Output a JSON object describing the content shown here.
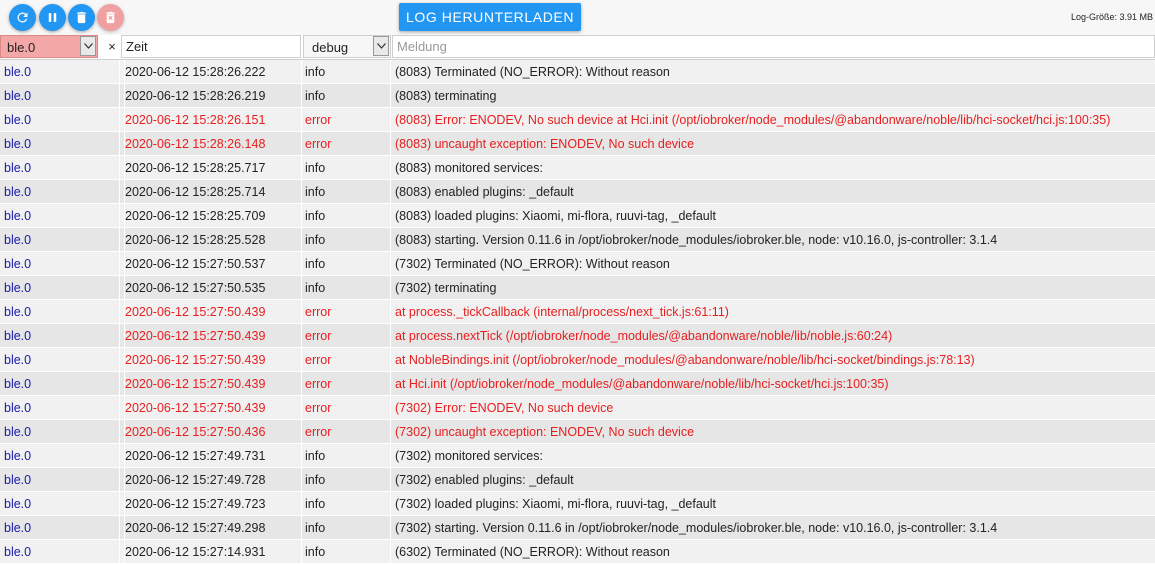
{
  "toolbar": {
    "refresh_icon": "refresh-icon",
    "pause_icon": "pause-icon",
    "clear_icon": "trash-icon",
    "delete_icon": "trash-delete-icon",
    "download_label": "LOG HERUNTERLADEN",
    "log_size": "Log-Größe: 3.91 MB"
  },
  "filters": {
    "source_value": "ble.0",
    "clear_label": "×",
    "time_value": "Zeit",
    "level_value": "debug",
    "message_placeholder": "Meldung"
  },
  "colors": {
    "accent": "#2196f3",
    "error": "#e81e1e",
    "source": "#1a1aa6",
    "filter_active": "#f4a7a7"
  },
  "rows": [
    {
      "source": "ble.0",
      "time": "2020-06-12 15:28:26.222",
      "level": "info",
      "message": "(8083) Terminated (NO_ERROR): Without reason"
    },
    {
      "source": "ble.0",
      "time": "2020-06-12 15:28:26.219",
      "level": "info",
      "message": "(8083) terminating"
    },
    {
      "source": "ble.0",
      "time": "2020-06-12 15:28:26.151",
      "level": "error",
      "message": "(8083) Error: ENODEV, No such device at Hci.init (/opt/iobroker/node_modules/@abandonware/noble/lib/hci-socket/hci.js:100:35)"
    },
    {
      "source": "ble.0",
      "time": "2020-06-12 15:28:26.148",
      "level": "error",
      "message": "(8083) uncaught exception: ENODEV, No such device"
    },
    {
      "source": "ble.0",
      "time": "2020-06-12 15:28:25.717",
      "level": "info",
      "message": "(8083) monitored services:"
    },
    {
      "source": "ble.0",
      "time": "2020-06-12 15:28:25.714",
      "level": "info",
      "message": "(8083) enabled plugins: _default"
    },
    {
      "source": "ble.0",
      "time": "2020-06-12 15:28:25.709",
      "level": "info",
      "message": "(8083) loaded plugins: Xiaomi, mi-flora, ruuvi-tag, _default"
    },
    {
      "source": "ble.0",
      "time": "2020-06-12 15:28:25.528",
      "level": "info",
      "message": "(8083) starting. Version 0.11.6 in /opt/iobroker/node_modules/iobroker.ble, node: v10.16.0, js-controller: 3.1.4"
    },
    {
      "source": "ble.0",
      "time": "2020-06-12 15:27:50.537",
      "level": "info",
      "message": "(7302) Terminated (NO_ERROR): Without reason"
    },
    {
      "source": "ble.0",
      "time": "2020-06-12 15:27:50.535",
      "level": "info",
      "message": "(7302) terminating"
    },
    {
      "source": "ble.0",
      "time": "2020-06-12 15:27:50.439",
      "level": "error",
      "message": "at process._tickCallback (internal/process/next_tick.js:61:11)"
    },
    {
      "source": "ble.0",
      "time": "2020-06-12 15:27:50.439",
      "level": "error",
      "message": "at process.nextTick (/opt/iobroker/node_modules/@abandonware/noble/lib/noble.js:60:24)"
    },
    {
      "source": "ble.0",
      "time": "2020-06-12 15:27:50.439",
      "level": "error",
      "message": "at NobleBindings.init (/opt/iobroker/node_modules/@abandonware/noble/lib/hci-socket/bindings.js:78:13)"
    },
    {
      "source": "ble.0",
      "time": "2020-06-12 15:27:50.439",
      "level": "error",
      "message": "at Hci.init (/opt/iobroker/node_modules/@abandonware/noble/lib/hci-socket/hci.js:100:35)"
    },
    {
      "source": "ble.0",
      "time": "2020-06-12 15:27:50.439",
      "level": "error",
      "message": "(7302) Error: ENODEV, No such device"
    },
    {
      "source": "ble.0",
      "time": "2020-06-12 15:27:50.436",
      "level": "error",
      "message": "(7302) uncaught exception: ENODEV, No such device"
    },
    {
      "source": "ble.0",
      "time": "2020-06-12 15:27:49.731",
      "level": "info",
      "message": "(7302) monitored services:"
    },
    {
      "source": "ble.0",
      "time": "2020-06-12 15:27:49.728",
      "level": "info",
      "message": "(7302) enabled plugins: _default"
    },
    {
      "source": "ble.0",
      "time": "2020-06-12 15:27:49.723",
      "level": "info",
      "message": "(7302) loaded plugins: Xiaomi, mi-flora, ruuvi-tag, _default"
    },
    {
      "source": "ble.0",
      "time": "2020-06-12 15:27:49.298",
      "level": "info",
      "message": "(7302) starting. Version 0.11.6 in /opt/iobroker/node_modules/iobroker.ble, node: v10.16.0, js-controller: 3.1.4"
    },
    {
      "source": "ble.0",
      "time": "2020-06-12 15:27:14.931",
      "level": "info",
      "message": "(6302) Terminated (NO_ERROR): Without reason"
    }
  ]
}
